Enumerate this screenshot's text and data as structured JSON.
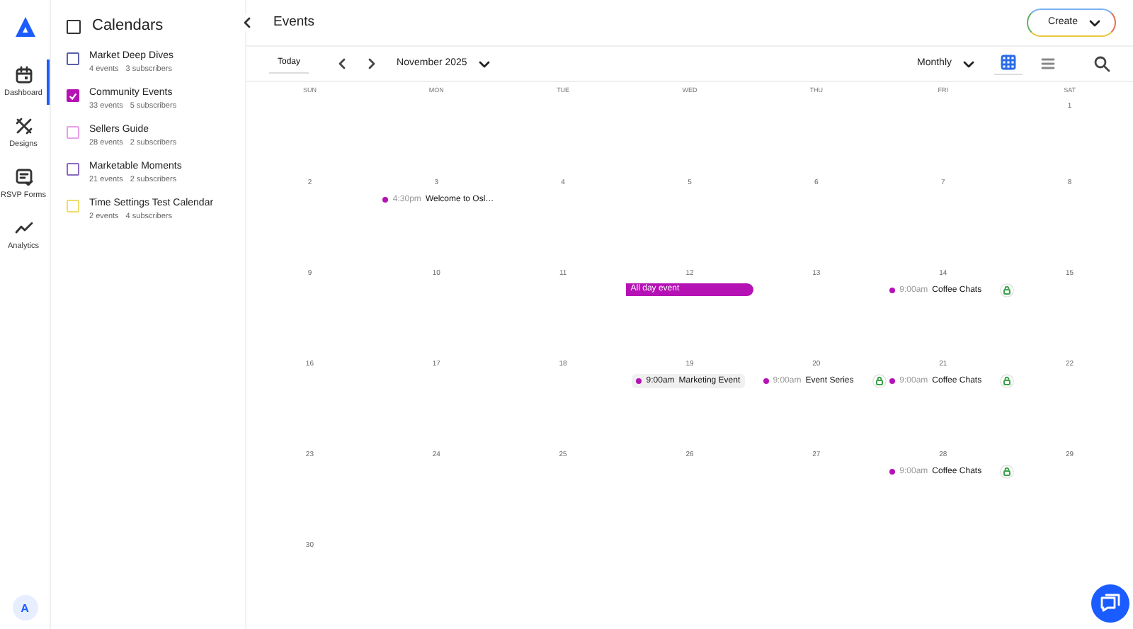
{
  "nav": {
    "items": [
      {
        "label": "Dashboard",
        "selected": true
      },
      {
        "label": "Designs",
        "selected": false
      },
      {
        "label": "RSVP Forms",
        "selected": false
      },
      {
        "label": "Analytics",
        "selected": false
      }
    ],
    "avatar": "A"
  },
  "calendars": {
    "title": "Calendars",
    "all_checked": false,
    "items": [
      {
        "name": "Market Deep Dives",
        "events": "4 events",
        "subscribers": "3 subscribers",
        "color": "#5b5fa8",
        "checked": false
      },
      {
        "name": "Community Events",
        "events": "33 events",
        "subscribers": "5 subscribers",
        "color": "#b512b5",
        "checked": true
      },
      {
        "name": "Sellers Guide",
        "events": "28 events",
        "subscribers": "2 subscribers",
        "color": "#e8a0e8",
        "checked": false
      },
      {
        "name": "Marketable Moments",
        "events": "21 events",
        "subscribers": "2 subscribers",
        "color": "#8a6cc4",
        "checked": false
      },
      {
        "name": "Time Settings Test Calendar",
        "events": "2 events",
        "subscribers": "4 subscribers",
        "color": "#f0dc6a",
        "checked": false
      }
    ]
  },
  "header": {
    "title": "Events",
    "create_button": "Create"
  },
  "toolbar": {
    "today": "Today",
    "month": "November 2025",
    "view": "Monthly",
    "grid_view_selected": true
  },
  "calendar": {
    "weekdays": [
      "SUN",
      "MON",
      "TUE",
      "WED",
      "THU",
      "FRI",
      "SAT"
    ],
    "weeks": [
      {
        "days": [
          {
            "date": "1"
          }
        ]
      },
      {
        "days": [
          {
            "date": "2"
          },
          {
            "date": "3",
            "events": [
              {
                "kind": "timed",
                "time": "4:30pm",
                "title": "Welcome to Osl…",
                "color": "#b512b5",
                "recurring": false,
                "highlighted": false
              }
            ]
          },
          {
            "date": "4"
          },
          {
            "date": "5"
          },
          {
            "date": "6"
          },
          {
            "date": "7"
          },
          {
            "date": "8"
          }
        ]
      },
      {
        "days": [
          {
            "date": "9"
          },
          {
            "date": "10"
          },
          {
            "date": "11"
          },
          {
            "date": "12",
            "events": [
              {
                "kind": "allday",
                "title": "All day event",
                "color": "#b512b5"
              }
            ]
          },
          {
            "date": "13"
          },
          {
            "date": "14",
            "events": [
              {
                "kind": "timed",
                "time": "9:00am",
                "title": "Coffee Chats",
                "color": "#b512b5",
                "recurring": true,
                "highlighted": false
              }
            ]
          },
          {
            "date": "15"
          }
        ]
      },
      {
        "days": [
          {
            "date": "16"
          },
          {
            "date": "17"
          },
          {
            "date": "18"
          },
          {
            "date": "19",
            "events": [
              {
                "kind": "timed",
                "time": "9:00am",
                "title": "Marketing Event",
                "color": "#b512b5",
                "recurring": false,
                "highlighted": true
              }
            ]
          },
          {
            "date": "20",
            "events": [
              {
                "kind": "timed",
                "time": "9:00am",
                "title": "Event Series",
                "color": "#b512b5",
                "recurring": true,
                "highlighted": false
              }
            ]
          },
          {
            "date": "21",
            "events": [
              {
                "kind": "timed",
                "time": "9:00am",
                "title": "Coffee Chats",
                "color": "#b512b5",
                "recurring": true,
                "highlighted": false
              }
            ]
          },
          {
            "date": "22"
          }
        ]
      },
      {
        "days": [
          {
            "date": "23"
          },
          {
            "date": "24"
          },
          {
            "date": "25"
          },
          {
            "date": "26"
          },
          {
            "date": "27"
          },
          {
            "date": "28",
            "events": [
              {
                "kind": "timed",
                "time": "9:00am",
                "title": "Coffee Chats",
                "color": "#b512b5",
                "recurring": true,
                "highlighted": false
              }
            ]
          },
          {
            "date": "29"
          }
        ]
      },
      {
        "days": [
          {
            "date": "30"
          }
        ]
      }
    ]
  }
}
